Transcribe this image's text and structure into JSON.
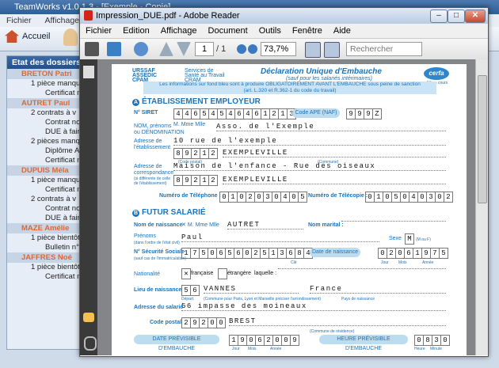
{
  "background_app": {
    "title": "TeamWorks v1.0.1.3 - [Exemple - Copie]",
    "menu": [
      "Fichier",
      "Affichage",
      "O"
    ],
    "home_label": "Accueil",
    "panel_title": "Etat des dossiers",
    "dossiers": [
      {
        "name": "BRETON Patri",
        "lines": [
          {
            "text": "1 pièce manqu",
            "subs": [
              "Certificat mé"
            ]
          }
        ]
      },
      {
        "name": "AUTRET Paul",
        "lines": [
          {
            "text": "2 contrats à v",
            "subs": [
              "Contrat non",
              "DUE à faire"
            ]
          },
          {
            "text": "2 pièces manqu",
            "subs": [
              "Diplôme A.F",
              "Certificat mé"
            ]
          }
        ]
      },
      {
        "name": "DUPUIS Méla",
        "lines": [
          {
            "text": "1 pièce manqu",
            "subs": [
              "Certificat mé"
            ]
          },
          {
            "text": "2 contrats à v",
            "subs": [
              "Contrat non",
              "DUE à faire"
            ]
          }
        ]
      },
      {
        "name": "MAZE Amélie",
        "lines": [
          {
            "text": "1 pièce bientôt",
            "subs": [
              "Bulletin n°3 d"
            ]
          }
        ]
      },
      {
        "name": "JAFFRES Noé",
        "lines": [
          {
            "text": "1 pièce bientôt",
            "subs": [
              "Certificat mé"
            ]
          }
        ]
      }
    ]
  },
  "reader": {
    "title": "Impression_DUE.pdf - Adobe Reader",
    "menu": [
      "Fichier",
      "Edition",
      "Affichage",
      "Document",
      "Outils",
      "Fenêtre",
      "Aide"
    ],
    "page_current": "1",
    "page_total": "/ 1",
    "zoom": "73,7%",
    "search_placeholder": "Rechercher",
    "window_buttons": {
      "minimize": "–",
      "maximize": "□",
      "close": "✕"
    }
  },
  "form": {
    "urssaf": "URSSAF\nASSEDIC\nCPAM",
    "services": "Services de\nSanté au Travail\nCRAM",
    "title": "Déclaration Unique d'Embauche",
    "subtitle": "(sauf pour les salariés intérimaires)",
    "cerfa": "cerfa",
    "cerfa_num": "N° en cours",
    "banner_line1": "Les informations sur fond bleu sont à produire OBLIGATOIREMENT AVANT L'EMBAUCHE sous peine de sanction",
    "banner_line2": "(art. L.320 et R.362-1 du code du travail)",
    "section_a_letter": "A",
    "section_a": "ÉTABLISSEMENT EMPLOYEUR",
    "siret_label": "N° SIRET",
    "siret": [
      "4",
      "4",
      "6",
      "5",
      "4",
      "5",
      "4",
      "6",
      "4",
      "6",
      "1",
      "2",
      "1",
      "3"
    ],
    "ape_label": "Code APE (NAF)",
    "ape": [
      "9",
      "9",
      "9",
      "Z"
    ],
    "nom_label": "NOM, prénoms\nou DÉNOMINATION",
    "civ_m": "M.",
    "civ_mme": "Mme",
    "civ_mlle": "Mlle",
    "nom_value": "Asso. de l'Exemple",
    "adresse_etab_label": "Adresse de\nl'établissement",
    "adresse_etab": "10 rue de l'exemple",
    "cp_commune_label": "(Code postal)",
    "commune_label": "(Commune)",
    "cp_etab": [
      "8",
      "9",
      "2",
      "1",
      "2"
    ],
    "ville_etab": "EXEMPLEVILLE",
    "corresp_label": "Adresse de\ncorrespondance",
    "corresp_sub": "(si différente de celle\nde l'établissement)",
    "corresp_addr": "Maison de l'enfance - Rue des oiseaux",
    "cp_corresp": [
      "8",
      "9",
      "2",
      "1",
      "2"
    ],
    "ville_corresp": "EXEMPLEVILLE",
    "tel_label": "Numéro de Téléphone :",
    "tel": [
      "0",
      "1",
      "0",
      "2",
      "0",
      "3",
      "0",
      "4",
      "0",
      "5"
    ],
    "fax_label": "Numéro de Télécopie :",
    "fax": [
      "0",
      "1",
      "0",
      "5",
      "0",
      "4",
      "0",
      "3",
      "0",
      "2"
    ],
    "section_b_letter": "B",
    "section_b": "FUTUR SALARIÉ",
    "nom_naissance_label": "Nom de naissance",
    "civ_checked": "✕",
    "nom_naissance": "AUTRET",
    "nom_marital_label": "Nom marital :",
    "prenoms_label": "Prénoms",
    "prenoms_sub": "(dans l'ordre de l'état civil)",
    "prenoms": "Paul",
    "sexe_label": "Sexe",
    "sexe": "M",
    "sexe_hint": "(M ou F)",
    "secu_label": "N° Sécurité Sociale",
    "secu_sub": "(sauf cas de l'immatriculation)",
    "secu": [
      "1",
      "7",
      "5",
      "0",
      "6",
      "5",
      "6",
      "0",
      "2",
      "5",
      "1",
      "3",
      "6",
      "8",
      "4"
    ],
    "cle_label": "Clé",
    "ddn_label": "Date de naissance",
    "ddn": [
      "0",
      "2",
      "0",
      "6",
      "1",
      "9",
      "7",
      "5"
    ],
    "jour": "Jour",
    "mois": "Mois",
    "annee": "Année",
    "nationalite_label": "Nationalité",
    "nat_fr_check": "✕",
    "nat_fr": "française",
    "nat_etr": "étrangère",
    "nat_laquelle": "laquelle :",
    "lieu_label": "Lieu de naissance",
    "lieu_dep": [
      "5",
      "6"
    ],
    "lieu_commune": "VANNES",
    "lieu_pays": "France",
    "dep_label": "Départ.",
    "commune_paris_label": "(Commune pour Paris, Lyon et Marseille préciser l'arrondissement)",
    "pays_label": "Pays de naissance",
    "adresse_sal_label": "Adresse du salarié",
    "adresse_sal": "56 impasse des moineaux",
    "cp_sal_label": "Code postal",
    "cp_sal": [
      "2",
      "9",
      "2",
      "0",
      "0"
    ],
    "ville_sal": "BREST",
    "commune_res_label": "(Commune de résidence)",
    "date_emb_label": "DATE PRÉVISIBLE D'EMBAUCHE",
    "date_emb": [
      "1",
      "9",
      "0",
      "6",
      "2",
      "0",
      "0",
      "9"
    ],
    "heure_emb_label": "HEURE PRÉVISIBLE D'EMBAUCHE",
    "heure_emb": [
      "0",
      "8",
      "3",
      "0"
    ],
    "heure": "Heure",
    "minute": "Minute"
  },
  "colors": {
    "form_blue": "#1d73b9",
    "form_light": "#cbe4f5",
    "dossier_name": "#d66a3a"
  }
}
